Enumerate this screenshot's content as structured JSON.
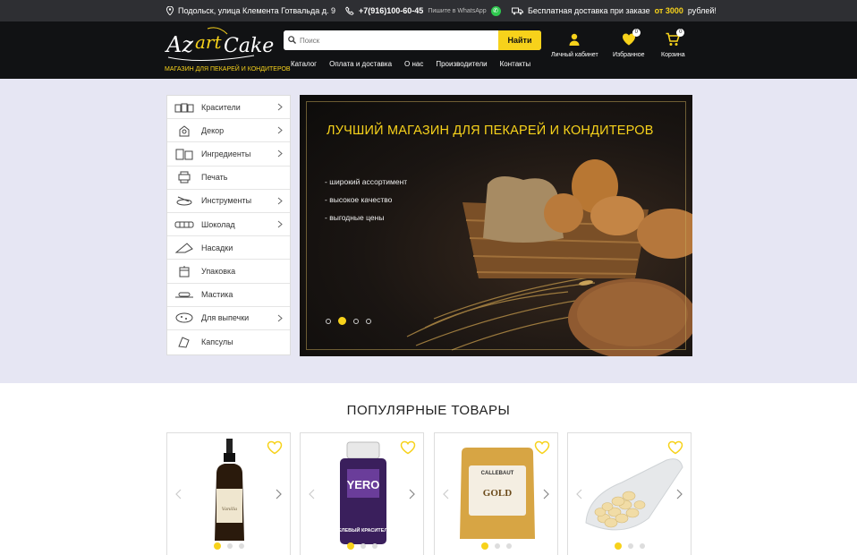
{
  "topbar": {
    "address": "Подольск, улица Клемента Готвальда д. 9",
    "phone": "+7(916)100-60-45",
    "whatsapp_text": "Пишите в WhatsApp",
    "delivery_prefix": "Бесплатная доставка при заказе",
    "delivery_from": "от 3000",
    "delivery_suffix": "рублей!"
  },
  "logo": {
    "text": "AzartCake",
    "tagline": "МАГАЗИН ДЛЯ ПЕКАРЕЙ И КОНДИТЕРОВ"
  },
  "search": {
    "placeholder": "Поиск",
    "button": "Найти"
  },
  "nav": [
    "Каталог",
    "Оплата и доставка",
    "О нас",
    "Производители",
    "Контакты"
  ],
  "header_icons": {
    "account": "Личный кабинет",
    "favorites": "Избранное",
    "favorites_count": "0",
    "cart": "Корзина",
    "cart_count": "0"
  },
  "categories": [
    {
      "label": "Красители",
      "has_sub": true
    },
    {
      "label": "Декор",
      "has_sub": true
    },
    {
      "label": "Ингредиенты",
      "has_sub": true
    },
    {
      "label": "Печать",
      "has_sub": false
    },
    {
      "label": "Инструменты",
      "has_sub": true
    },
    {
      "label": "Шоколад",
      "has_sub": true
    },
    {
      "label": "Насадки",
      "has_sub": false
    },
    {
      "label": "Упаковка",
      "has_sub": false
    },
    {
      "label": "Мастика",
      "has_sub": false
    },
    {
      "label": "Для выпечки",
      "has_sub": true
    },
    {
      "label": "Капсулы",
      "has_sub": false
    }
  ],
  "banner": {
    "title": "ЛУЧШИЙ МАГАЗИН  ДЛЯ ПЕКАРЕЙ И КОНДИТЕРОВ",
    "bullets": [
      "- широкий ассортимент",
      "- высокое качество",
      "- выгодные цены"
    ],
    "slides": 4,
    "active_slide": 1
  },
  "popular": {
    "title": "ПОПУЛЯРНЫЕ ТОВАРЫ",
    "products": [
      {
        "name": "bottle-flavoring",
        "label": "",
        "active_image": 0
      },
      {
        "name": "yero-gel-dye",
        "label": "ГЕЛЕВЫЙ КРАСИТЕЛЬ",
        "brand": "YERO",
        "active_image": 0
      },
      {
        "name": "callebaut-gold",
        "brand": "CALLEBAUT",
        "label": "GOLD",
        "active_image": 0
      },
      {
        "name": "white-chocolate-drops",
        "label": "",
        "active_image": 0
      }
    ]
  },
  "colors": {
    "accent": "#f7d21b",
    "header_bg": "#111214",
    "topbar_bg": "#2e2f33",
    "hero_bg": "#e6e6f3"
  }
}
